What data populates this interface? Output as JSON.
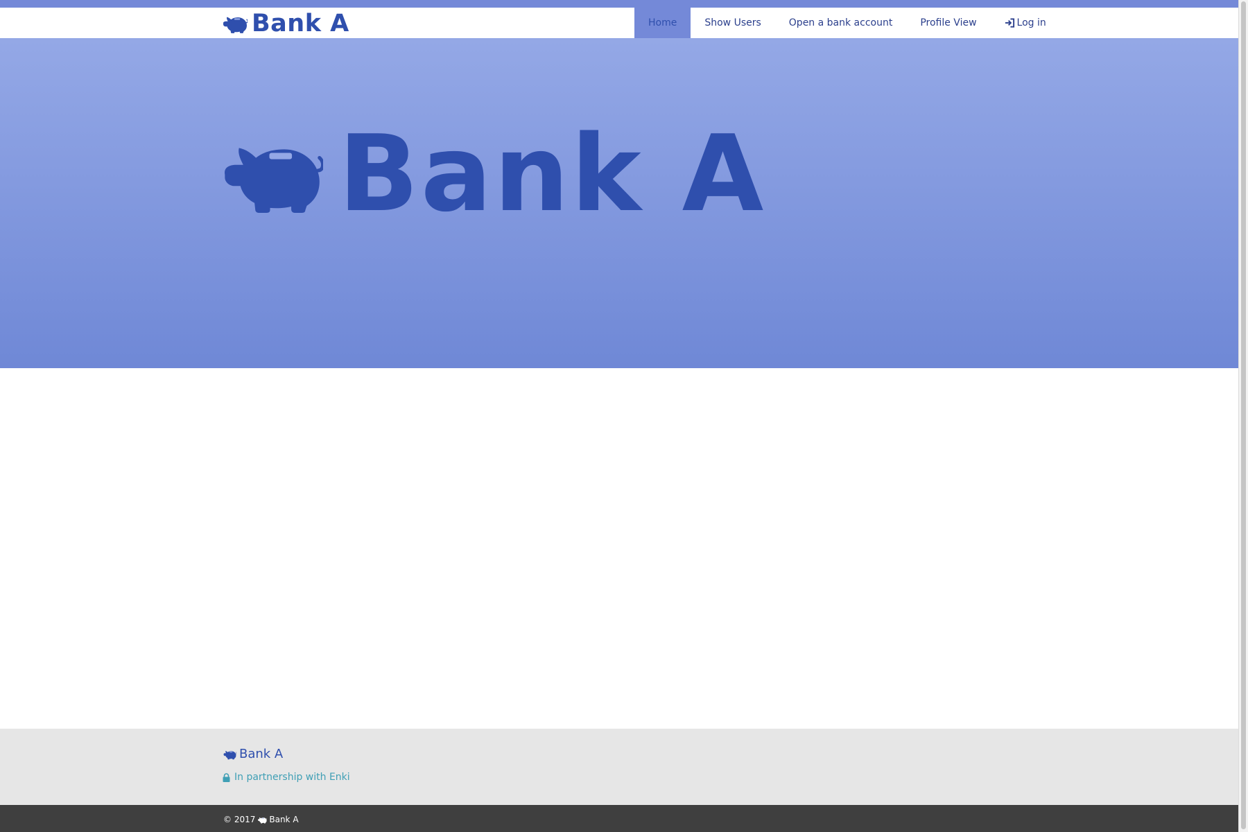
{
  "header": {
    "brand_text": "Bank A",
    "brand_icon": "piggy-bank-icon",
    "nav": [
      {
        "label": "Home",
        "active": true
      },
      {
        "label": "Show Users",
        "active": false
      },
      {
        "label": "Open a bank account",
        "active": false
      },
      {
        "label": "Profile View",
        "active": false
      },
      {
        "label": "Log in",
        "active": false,
        "icon": "log-in-icon"
      }
    ]
  },
  "hero": {
    "title": "Bank A",
    "icon": "piggy-bank-icon"
  },
  "footer": {
    "brand_text": "Bank A",
    "partnership_text": "In partnership with Enki",
    "partnership_icon": "lock-icon",
    "copyright_text": "© 2017",
    "copyright_brand": "Bank A"
  },
  "colors": {
    "brand": "#2f4fad",
    "accent": "#7489d8",
    "hero_top": "#94a8e6",
    "hero_bottom": "#6f88d6",
    "partnership": "#3f9fb5",
    "footer_bg": "#e6e6e6",
    "bottombar_bg": "#3f3f3f"
  }
}
